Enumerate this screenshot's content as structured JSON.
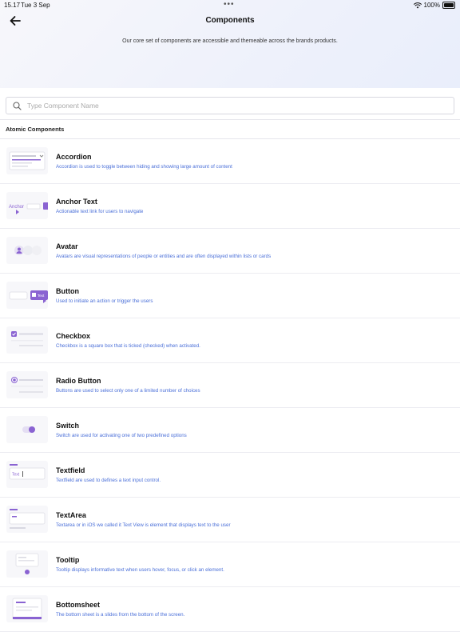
{
  "status_bar": {
    "time": "15.17",
    "date": "Tue 3 Sep",
    "battery": "100%"
  },
  "header": {
    "title": "Components",
    "subtitle": "Our core set of components are accessible and themeable across the brands products."
  },
  "search": {
    "placeholder": "Type Component Name",
    "value": ""
  },
  "section": {
    "heading": "Atomic Components"
  },
  "components": [
    {
      "name": "Accordion",
      "description": "Accordion is used to toggle between hiding and showing large amount of content",
      "thumb": "accordion"
    },
    {
      "name": "Anchor Text",
      "description": "Actionable text link for users to navigate",
      "thumb": "anchor"
    },
    {
      "name": "Avatar",
      "description": "Avatars are visual representations of people or entities and are often displayed within lists or cards",
      "thumb": "avatar"
    },
    {
      "name": "Button",
      "description": "Used to initiate an action or trigger the users",
      "thumb": "button"
    },
    {
      "name": "Checkbox",
      "description": "Checkbox is a square box that is ticked (checked) when activated.",
      "thumb": "checkbox"
    },
    {
      "name": "Radio Button",
      "description": "Buttons are used to select only one of a limited number of choices",
      "thumb": "radio"
    },
    {
      "name": "Switch",
      "description": "Switch are used for activating one of two predefined options",
      "thumb": "switch"
    },
    {
      "name": "Textfield",
      "description": "Textfield are used to defines a text input control.",
      "thumb": "textfield"
    },
    {
      "name": "TextArea",
      "description": "Textarea or in iOS we called it Text View is element that displays text to the user",
      "thumb": "textarea"
    },
    {
      "name": "Tooltip",
      "description": "Tooltip displays informative text when users hover, focus, or click an element.",
      "thumb": "tooltip"
    },
    {
      "name": "Bottomsheet",
      "description": "The bottom sheet is a slides from the bottom of the screen.",
      "thumb": "bottomsheet"
    }
  ],
  "thumb_labels": {
    "anchor": "Anchor",
    "button": "Text",
    "textfield": "Text"
  },
  "colors": {
    "accent": "#8a63d2",
    "link": "#4a6fd8"
  }
}
